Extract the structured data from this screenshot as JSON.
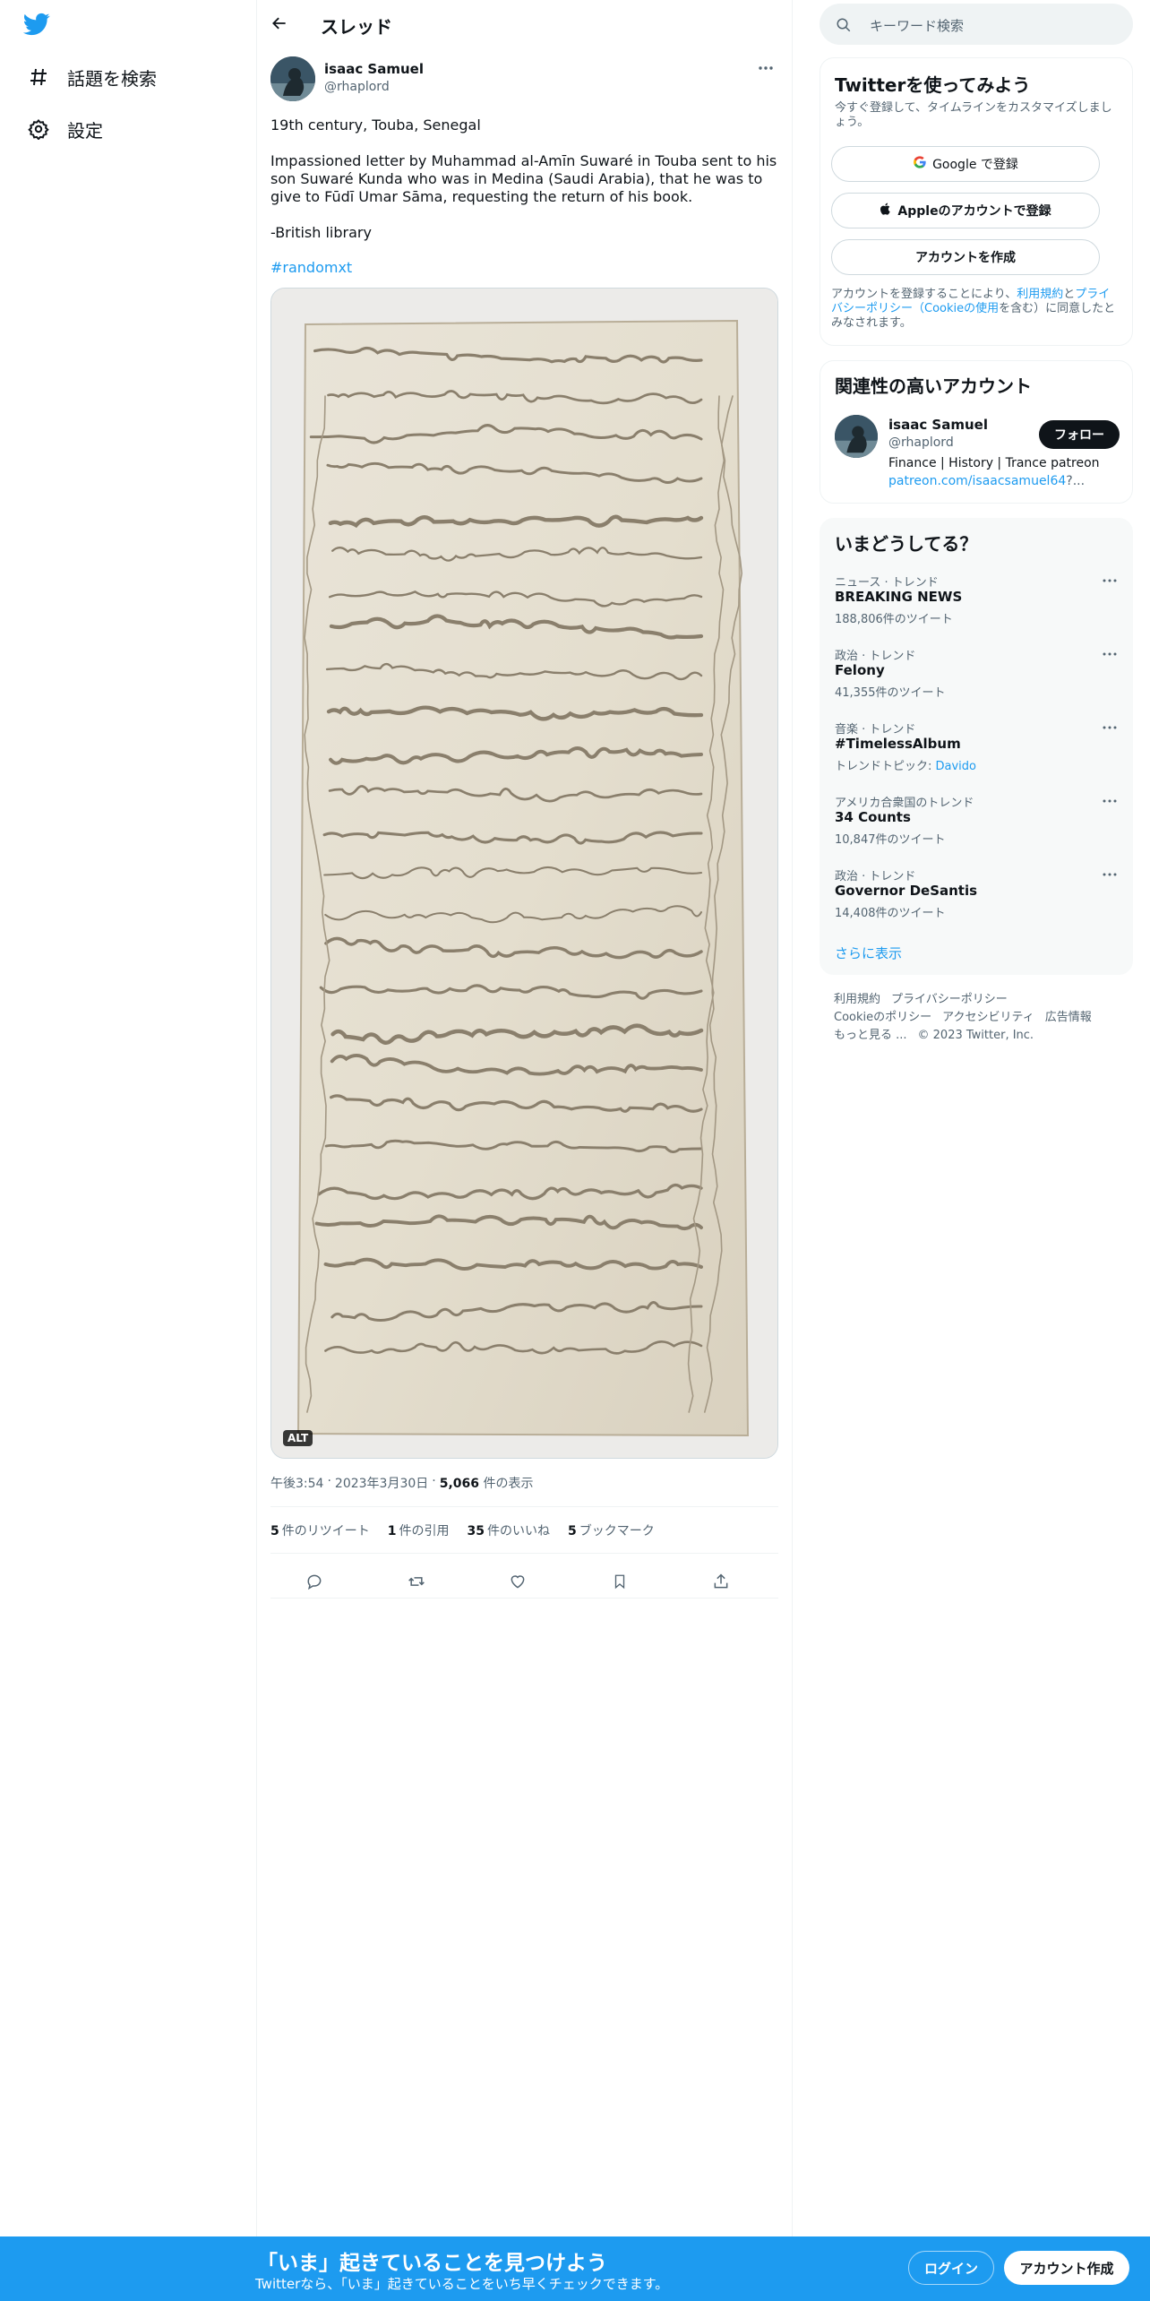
{
  "nav": {
    "items": [
      {
        "label": "話題を検索",
        "icon": "hashtag-icon"
      },
      {
        "label": "設定",
        "icon": "gear-icon"
      }
    ]
  },
  "header": {
    "title": "スレッド"
  },
  "tweet": {
    "author_name": "isaac Samuel",
    "author_handle": "@rhaplord",
    "paragraphs": [
      "19th century, Touba, Senegal",
      "Impassioned letter by Muhammad al-Amīn Suwaré in Touba sent to his son Suwaré Kunda who was in Medina (Saudi Arabia), that he was to give to Fūdī Umar Sāma, requesting the return of his book.",
      "-British library"
    ],
    "hashtag": "#randomxt",
    "alt_badge": "ALT",
    "time": "午後3:54",
    "date": "2023年3月30日",
    "views_count": "5,066",
    "views_label": "件の表示",
    "dot": "·",
    "stats": [
      {
        "num": "5",
        "label": "件のリツイート"
      },
      {
        "num": "1",
        "label": "件の引用"
      },
      {
        "num": "35",
        "label": "件のいいね"
      },
      {
        "num": "5",
        "label": "ブックマーク"
      }
    ]
  },
  "search": {
    "placeholder": "キーワード検索"
  },
  "signup_panel": {
    "title": "Twitterを使ってみよう",
    "subtitle": "今すぐ登録して、タイムラインをカスタマイズしましょう。",
    "google_button": "Google で登録",
    "apple_button": "Appleのアカウントで登録",
    "create_button": "アカウントを作成",
    "terms_prefix": "アカウントを登録することにより、",
    "terms_link1": "利用規約",
    "terms_and": "と",
    "terms_link2": "プライバシーポリシー（Cookieの使用",
    "terms_suffix": "を含む）に同意したとみなされます。"
  },
  "related_panel": {
    "title": "関連性の高いアカウント",
    "name": "isaac Samuel",
    "handle": "@rhaplord",
    "follow_button": "フォロー",
    "bio": "Finance | History | Trance patreon",
    "bio_link": "patreon.com/isaacsamuel64",
    "bio_tail": "?..."
  },
  "trends_panel": {
    "title": "いまどうしてる？",
    "items": [
      {
        "category": "ニュース · トレンド",
        "name": "BREAKING NEWS",
        "count": "188,806件のツイート"
      },
      {
        "category": "政治 · トレンド",
        "name": "Felony",
        "count": "41,355件のツイート"
      },
      {
        "category": "音楽 · トレンド",
        "name": "#TimelessAlbum",
        "count_prefix": "トレンドトピック: ",
        "count_link": "Davido"
      },
      {
        "category": "アメリカ合衆国のトレンド",
        "name": "34 Counts",
        "count": "10,847件のツイート"
      },
      {
        "category": "政治 · トレンド",
        "name": "Governor DeSantis",
        "count": "14,408件のツイート"
      }
    ],
    "show_more": "さらに表示"
  },
  "footer": {
    "links_row1": [
      "利用規約",
      "プライバシーポリシー"
    ],
    "links_row2": [
      "Cookieのポリシー",
      "アクセシビリティ",
      "広告情報"
    ],
    "more": "もっと見る ...",
    "copyright": "© 2023 Twitter, Inc."
  },
  "bottom_bar": {
    "title": "「いま」起きていることを見つけよう",
    "subtitle": "Twitterなら、「いま」起きていることをいち早くチェックできます。",
    "login": "ログイン",
    "signup": "アカウント作成"
  },
  "colors": {
    "accent": "#1d9bf0",
    "text": "#0f1419",
    "muted": "#536471"
  }
}
